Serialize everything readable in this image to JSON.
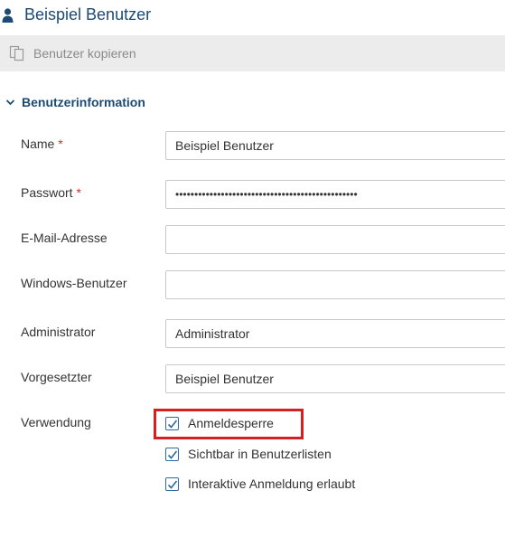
{
  "header": {
    "title": "Beispiel Benutzer",
    "icon": "user-icon"
  },
  "toolbar": {
    "copy_label": "Benutzer kopieren",
    "copy_icon": "copy-icon"
  },
  "section": {
    "title": "Benutzerinformation",
    "expanded": true
  },
  "form": {
    "name_label": "Name",
    "name_value": "Beispiel Benutzer",
    "password_label": "Passwort",
    "password_mask": "••••••••••••••••••••••••••••••••••••••••••••••••",
    "email_label": "E-Mail-Adresse",
    "email_value": "",
    "windows_label": "Windows-Benutzer",
    "windows_value": "",
    "admin_label": "Administrator",
    "admin_value": "Administrator",
    "supervisor_label": "Vorgesetzter",
    "supervisor_value": "Beispiel Benutzer",
    "usage_label": "Verwendung",
    "required_mark": "*"
  },
  "usage_options": [
    {
      "label": "Anmeldesperre",
      "checked": true,
      "highlighted": true
    },
    {
      "label": "Sichtbar in Benutzerlisten",
      "checked": true
    },
    {
      "label": "Interaktive Anmeldung erlaubt",
      "checked": true
    }
  ],
  "colors": {
    "accent": "#1d4a74",
    "checkbox": "#2e6aa1",
    "highlight": "#d42020",
    "toolbar_bg": "#ececec",
    "required": "#c0392b"
  }
}
